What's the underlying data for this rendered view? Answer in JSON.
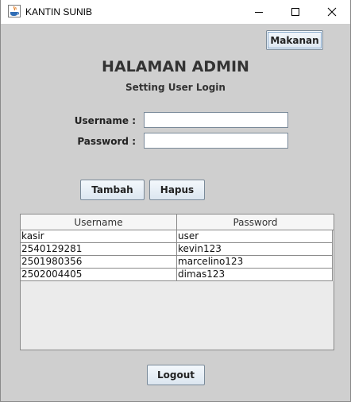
{
  "window": {
    "title": "KANTIN SUNIB",
    "controls": [
      "minimize",
      "maximize",
      "close"
    ]
  },
  "toolbar": {
    "makanan_label": "Makanan"
  },
  "header": {
    "title": "HALAMAN ADMIN",
    "subtitle": "Setting User Login"
  },
  "form": {
    "username_label": "Username :",
    "username_value": "",
    "password_label": "Password :",
    "password_value": ""
  },
  "actions": {
    "tambah_label": "Tambah",
    "hapus_label": "Hapus",
    "logout_label": "Logout"
  },
  "table": {
    "columns": [
      "Username",
      "Password"
    ],
    "rows": [
      [
        "kasir",
        "user"
      ],
      [
        "2540129281",
        "kevin123"
      ],
      [
        "2501980356",
        "marcelino123"
      ],
      [
        "2502004405",
        "dimas123"
      ]
    ]
  }
}
